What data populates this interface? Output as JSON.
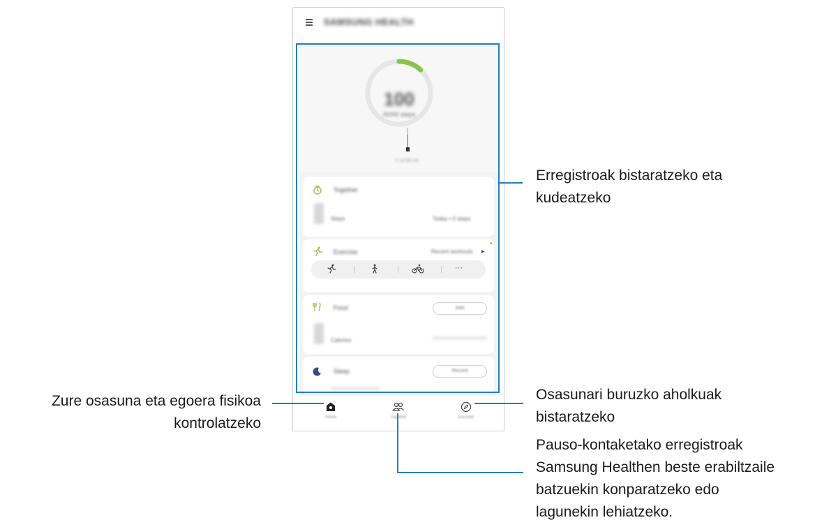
{
  "app": {
    "title": "SAMSUNG HEALTH",
    "menu_icon": "hamburger-menu-icon"
  },
  "steps": {
    "value": "100",
    "goal": "/6000 steps",
    "progress": 0.12,
    "bar_caption": "0      12:00      24"
  },
  "cards": {
    "together": {
      "title": "Together",
      "label": "Steps",
      "value": "Today • 0 steps",
      "icon": "timer-icon"
    },
    "exercise": {
      "title": "Exercise",
      "action": "Recent workouts",
      "activities": [
        "running-icon",
        "walking-icon",
        "cycling-icon",
        "more-icon"
      ],
      "more_label": "···"
    },
    "food": {
      "title": "Food",
      "button": "Add",
      "label": "Calories",
      "icon": "fork-knife-icon"
    },
    "sleep": {
      "title": "Sleep",
      "button": "Record",
      "icon": "moon-icon"
    }
  },
  "nav": {
    "home": "Home",
    "together": "Together",
    "discover": "Discover"
  },
  "callouts": {
    "records": [
      "Erregistroak bistaratzeko eta",
      "kudeatzeko"
    ],
    "home": [
      "Zure osasuna eta egoera fisikoa",
      "kontrolatzeko"
    ],
    "discover": [
      "Osasunari buruzko aholkuak",
      "bistaratzeko"
    ],
    "together": [
      "Pauso-kontaketako erregistroak",
      "Samsung Healthen beste erabiltzaile",
      "batzuekin konparatzeko edo",
      "lagunekin lehiatzeko."
    ]
  },
  "colors": {
    "accent": "#1f7fc1",
    "progress": "#8bc34a"
  }
}
